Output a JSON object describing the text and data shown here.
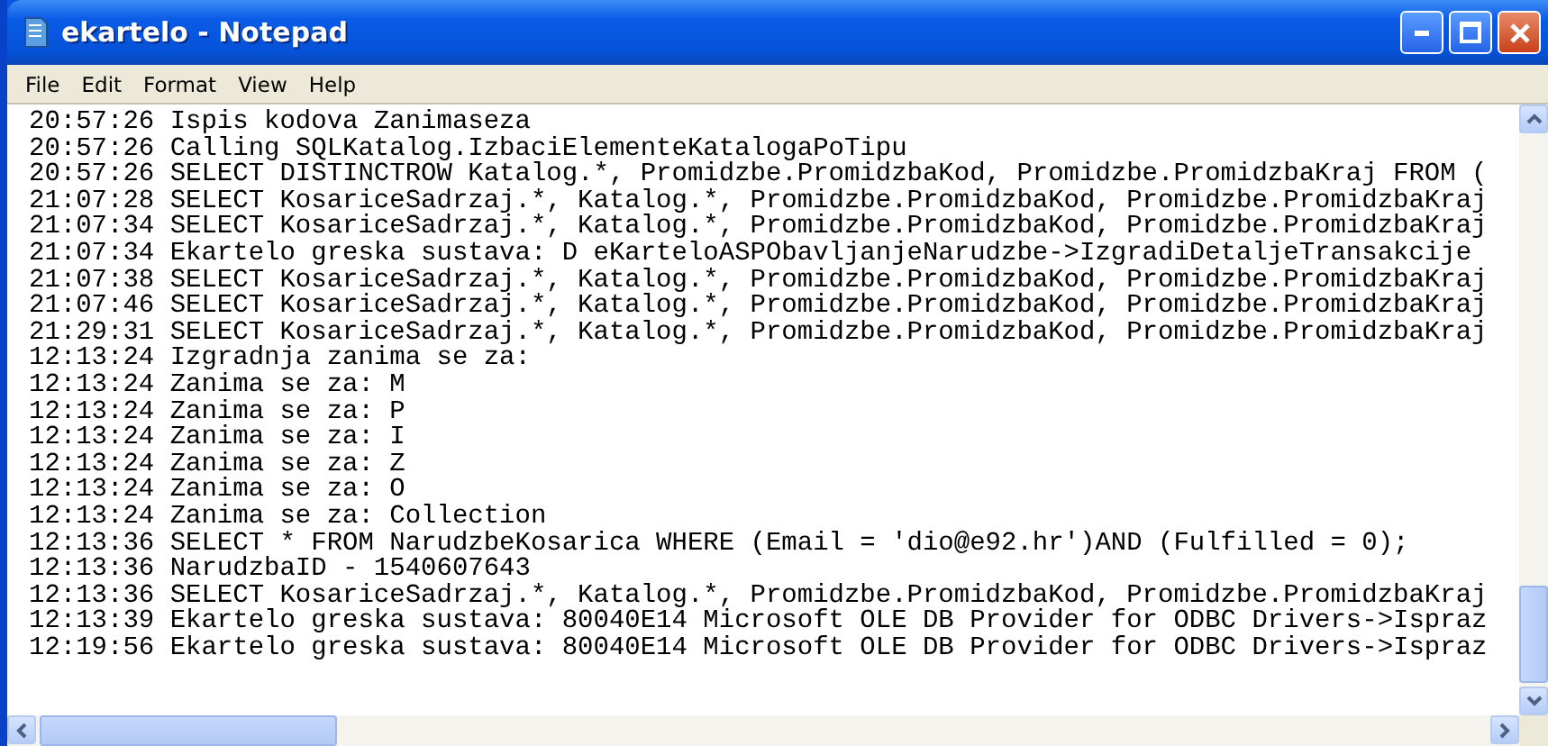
{
  "window": {
    "title": "ekartelo - Notepad",
    "controls": [
      {
        "kind": "minimize"
      },
      {
        "kind": "maximize"
      },
      {
        "kind": "close"
      }
    ]
  },
  "menu": [
    "File",
    "Edit",
    "Format",
    "View",
    "Help"
  ],
  "lines": [
    "20:57:26 Ispis kodova Zanimaseza",
    "20:57:26 Calling SQLKatalog.IzbaciElementeKatalogaPoTipu",
    "20:57:26 SELECT DISTINCTROW Katalog.*, Promidzbe.PromidzbaKod, Promidzbe.PromidzbaKraj FROM (",
    "21:07:28 SELECT KosariceSadrzaj.*, Katalog.*, Promidzbe.PromidzbaKod, Promidzbe.PromidzbaKraj",
    "21:07:34 SELECT KosariceSadrzaj.*, Katalog.*, Promidzbe.PromidzbaKod, Promidzbe.PromidzbaKraj",
    "21:07:34 Ekartelo greska sustava: D eKarteloASPObavljanjeNarudzbe->IzgradiDetaljeTransakcije",
    "21:07:38 SELECT KosariceSadrzaj.*, Katalog.*, Promidzbe.PromidzbaKod, Promidzbe.PromidzbaKraj",
    "21:07:46 SELECT KosariceSadrzaj.*, Katalog.*, Promidzbe.PromidzbaKod, Promidzbe.PromidzbaKraj",
    "21:29:31 SELECT KosariceSadrzaj.*, Katalog.*, Promidzbe.PromidzbaKod, Promidzbe.PromidzbaKraj",
    "12:13:24 Izgradnja zanima se za:",
    "12:13:24 Zanima se za: M",
    "12:13:24 Zanima se za: P",
    "12:13:24 Zanima se za: I",
    "12:13:24 Zanima se za: Z",
    "12:13:24 Zanima se za: O",
    "12:13:24 Zanima se za: Collection",
    "12:13:36 SELECT * FROM NarudzbeKosarica WHERE (Email = 'dio@e92.hr')AND (Fulfilled = 0);",
    "12:13:36 NarudzbaID - 1540607643",
    "12:13:36 SELECT KosariceSadrzaj.*, Katalog.*, Promidzbe.PromidzbaKod, Promidzbe.PromidzbaKraj",
    "12:13:39 Ekartelo greska sustava: 80040E14 Microsoft OLE DB Provider for ODBC Drivers->Ispraz",
    "12:19:56 Ekartelo greska sustava: 80040E14 Microsoft OLE DB Provider for ODBC Drivers->Ispraz"
  ]
}
